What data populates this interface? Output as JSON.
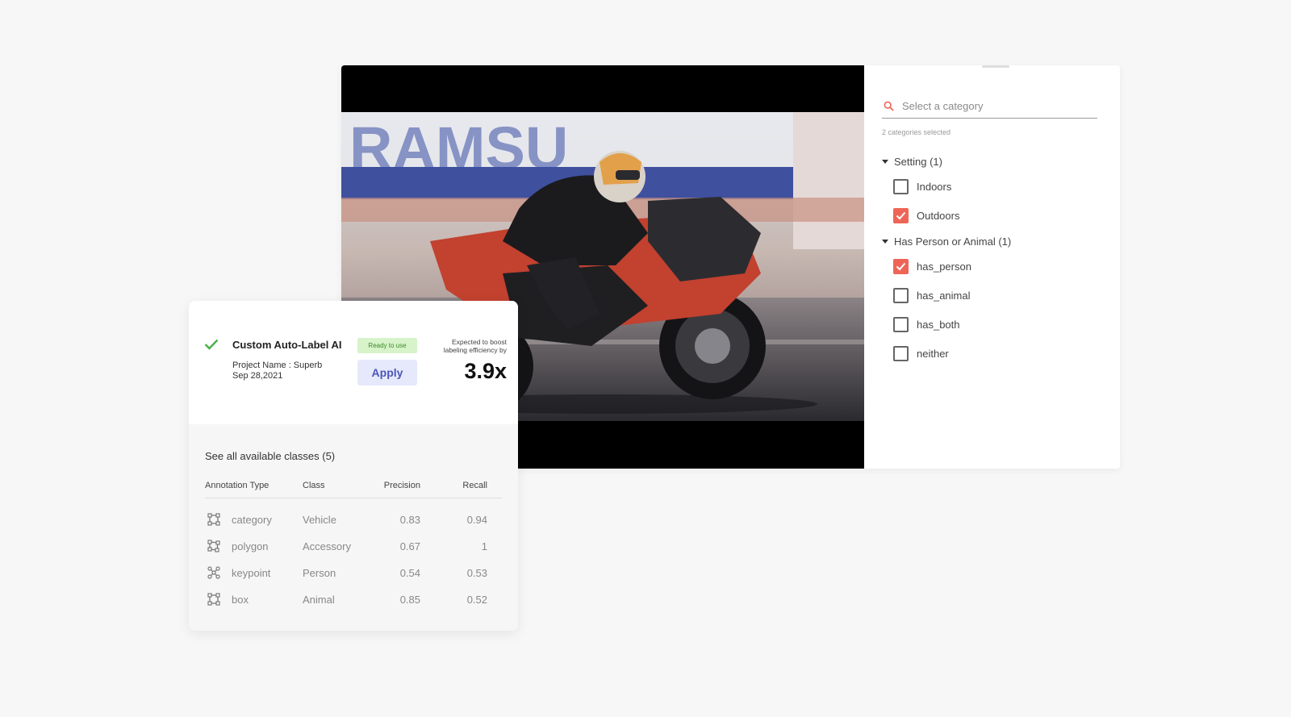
{
  "category_panel": {
    "search_placeholder": "Select a category",
    "selected_count": "2 categories selected",
    "groups": [
      {
        "label": "Setting (1)",
        "items": [
          {
            "label": "Indoors",
            "checked": false
          },
          {
            "label": "Outdoors",
            "checked": true
          }
        ]
      },
      {
        "label": "Has Person or Animal (1)",
        "items": [
          {
            "label": "has_person",
            "checked": true
          },
          {
            "label": "has_animal",
            "checked": false
          },
          {
            "label": "has_both",
            "checked": false
          },
          {
            "label": "neither",
            "checked": false
          }
        ]
      }
    ]
  },
  "autolabel": {
    "title": "Custom Auto-Label AI",
    "project": "Project Name : Superb",
    "date": "Sep 28,2021",
    "badge": "Ready to use",
    "apply_label": "Apply",
    "boost_line1": "Expected to boost",
    "boost_line2": "labeling efficiency by",
    "boost_value": "3.9x",
    "classes_link": "See all available classes (5)",
    "table": {
      "headers": [
        "Annotation Type",
        "Class",
        "Precision",
        "Recall"
      ],
      "rows": [
        {
          "type": "category",
          "icon": "box-icon",
          "class": "Vehicle",
          "precision": "0.83",
          "recall": "0.94"
        },
        {
          "type": "polygon",
          "icon": "polygon-icon",
          "class": "Accessory",
          "precision": "0.67",
          "recall": "1"
        },
        {
          "type": "keypoint",
          "icon": "keypoint-icon",
          "class": "Person",
          "precision": "0.54",
          "recall": "0.53"
        },
        {
          "type": "box",
          "icon": "box-icon",
          "class": "Animal",
          "precision": "0.85",
          "recall": "0.52"
        }
      ]
    }
  },
  "colors": {
    "accent": "#ee6557",
    "apply_text": "#4a55b8",
    "apply_bg": "#e6e9fb",
    "badge_bg": "#d7f3c9",
    "check_green": "#49b04a"
  }
}
